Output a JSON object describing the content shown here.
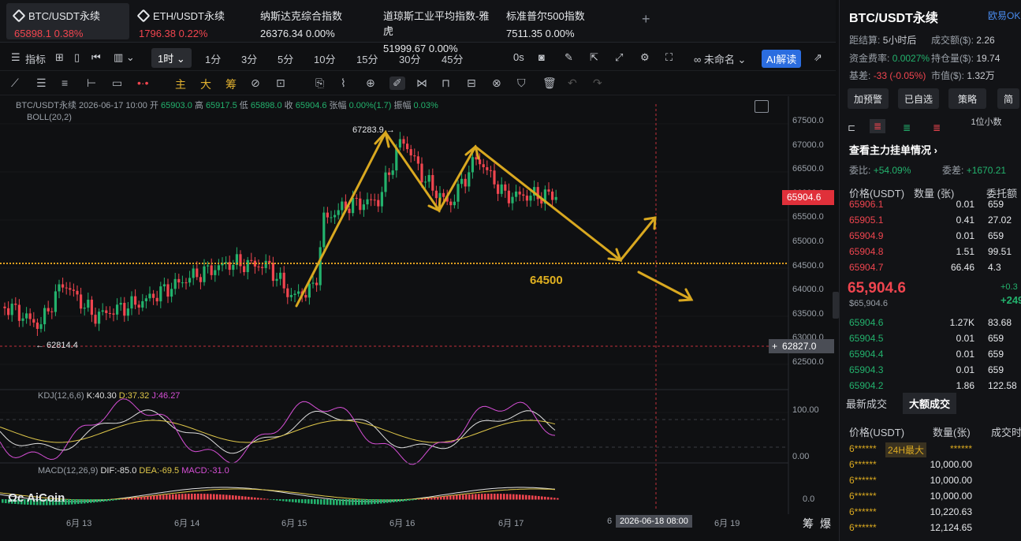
{
  "tabs": [
    {
      "name": "BTC/USDT永续",
      "price": "65898.1",
      "change": "0.38%",
      "color": "red"
    },
    {
      "name": "ETH/USDT永续",
      "price": "1796.38",
      "change": "0.22%",
      "color": "red"
    },
    {
      "name": "纳斯达克综合指数",
      "price": "26376.34",
      "change": "0.00%"
    },
    {
      "name": "道琼斯工业平均指数-雅虎",
      "price": "51999.67",
      "change": "0.00%"
    },
    {
      "name": "标准普尔500指数",
      "price": "7511.35",
      "change": "0.00%"
    }
  ],
  "toolbar": {
    "indicators": "指标",
    "interval": "1时",
    "periods": [
      "1分",
      "3分",
      "5分",
      "10分",
      "15分",
      "30分",
      "45分"
    ],
    "zero_s": "0s",
    "layout_name": "未命名",
    "ai": "AI解读"
  },
  "drawbar": {
    "main": "主",
    "big": "大",
    "chip": "筹"
  },
  "chart": {
    "info": "BTC/USDT永续 2026-06-17 10:00",
    "open_label": "开",
    "open": "65903.0",
    "high_label": "高",
    "high": "65917.5",
    "low_label": "低",
    "low": "65898.0",
    "close_label": "收",
    "close": "65904.6",
    "chg_label": "张幅",
    "chg": "0.00%(1.7)",
    "amp_label": "振幅",
    "amp": "0.03%",
    "boll": "BOLL(20,2)",
    "yticks": [
      "67500.0",
      "67000.0",
      "66500.0",
      "66000.0",
      "65500.0",
      "65000.0",
      "64500.0",
      "64000.0",
      "63500.0",
      "63000.0",
      "62500.0"
    ],
    "current_price": "65904.6",
    "cross_price": "62827.0",
    "high_mark": "67283.9 →",
    "low_mark": "← 62814.4",
    "annotation": "64500",
    "xticks": [
      "6月 13",
      "6月 14",
      "6月 15",
      "6月 16",
      "6月 17",
      "6",
      "6月 19"
    ],
    "cross_date": "2026-06-18 08:00",
    "btn_chip": "筹",
    "btn_burst": "爆"
  },
  "kdj": {
    "name": "KDJ(12,6,6)",
    "k": "K:40.30",
    "d": "D:37.32",
    "j": "J:46.27",
    "top": "100.00",
    "bottom": "0.00"
  },
  "macd": {
    "name": "MACD(12,26,9)",
    "dif": "DIF:-85.0",
    "dea": "DEA:-69.5",
    "macd": "MACD:-31.0",
    "zero": "0.0"
  },
  "logo": "AiCoin",
  "right": {
    "title": "BTC/USDT永续",
    "exchange": "欧易OK",
    "settle_label": "距结算:",
    "settle": "5小时后",
    "turnover_label": "成交额($):",
    "turnover": "2.26",
    "funding_label": "资金费率:",
    "funding": "0.0027%",
    "oi_label": "持仓量($):",
    "oi": "19.74",
    "basis_label": "基差:",
    "basis": "-33 (-0.05%)",
    "mcap_label": "市值($):",
    "mcap": "1.32万",
    "buttons": [
      "加预警",
      "已自选",
      "策略",
      "简"
    ],
    "depth": "1位小数",
    "main_orders": "查看主力挂单情况",
    "ratio_label": "委比:",
    "ratio": "+54.09%",
    "diff_label": "委差:",
    "diff": "+1670.21",
    "cols": [
      "价格(USDT)",
      "数量 (张)",
      "委托额"
    ],
    "asks": [
      [
        "65906.1",
        "0.01",
        "659"
      ],
      [
        "65905.1",
        "0.41",
        "27.02"
      ],
      [
        "65904.9",
        "0.01",
        "659"
      ],
      [
        "65904.8",
        "1.51",
        "99.51"
      ],
      [
        "65904.7",
        "66.46",
        "4.3"
      ]
    ],
    "last": "65,904.6",
    "last_usd": "$65,904.6",
    "last_r1": "+0.3",
    "last_r2": "+249",
    "bids": [
      [
        "65904.6",
        "1.27K",
        "83.68"
      ],
      [
        "65904.5",
        "0.01",
        "659"
      ],
      [
        "65904.4",
        "0.01",
        "659"
      ],
      [
        "65904.3",
        "0.01",
        "659"
      ],
      [
        "65904.2",
        "1.86",
        "122.58"
      ]
    ],
    "trade_tabs": [
      "最新成交",
      "大额成交"
    ],
    "trade_cols": [
      "价格(USDT)",
      "数量(张)",
      "成交时"
    ],
    "trades": [
      [
        "6******",
        "24H最大",
        "******"
      ],
      [
        "6******",
        "",
        "10,000.00"
      ],
      [
        "6******",
        "",
        "10,000.00"
      ],
      [
        "6******",
        "",
        "10,000.00"
      ],
      [
        "6******",
        "",
        "10,220.63"
      ],
      [
        "6******",
        "",
        "12,124.65"
      ]
    ]
  },
  "colors": {
    "up": "#23b26d",
    "down": "#f0454f",
    "arrow": "#d9a820",
    "kdj_k": "#e0e0e0",
    "kdj_d": "#e0c84a",
    "kdj_j": "#d64fd6"
  }
}
